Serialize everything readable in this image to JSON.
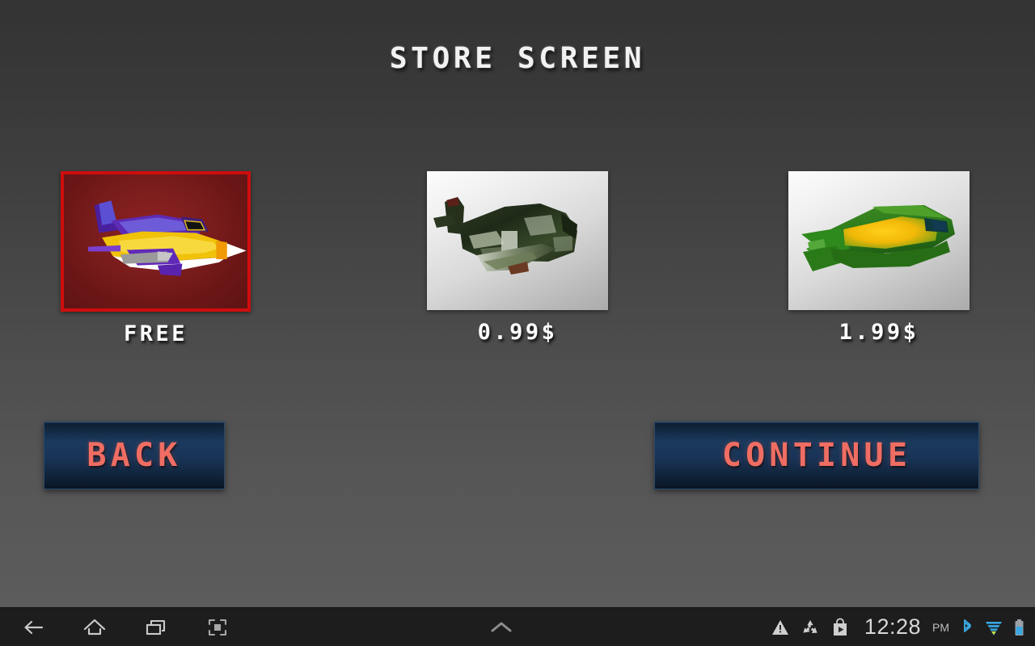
{
  "screen": {
    "title": "STORE SCREEN"
  },
  "products": [
    {
      "id": "plane-free",
      "price_label": "FREE",
      "selected": true,
      "art_name": "purple-yellow-jet-thumbnail",
      "frame_color": "#cf0d0d",
      "background": "#7d1d1d"
    },
    {
      "id": "plane-camo",
      "price_label": "0.99$",
      "selected": false,
      "art_name": "camo-green-fighter-thumbnail",
      "frame_color": "#d9d9d9",
      "background": "#e8e8e8"
    },
    {
      "id": "plane-green",
      "price_label": "1.99$",
      "selected": false,
      "art_name": "green-yellow-jet-thumbnail",
      "frame_color": "#d9d9d9",
      "background": "#e8e8e8"
    }
  ],
  "buttons": {
    "back_label": "BACK",
    "continue_label": "CONTINUE",
    "text_color": "#ef6d63",
    "fill_color": "#173354"
  },
  "navbar": {
    "icons": [
      {
        "name": "back-icon",
        "label": "Back"
      },
      {
        "name": "home-icon",
        "label": "Home"
      },
      {
        "name": "recent-apps-icon",
        "label": "Recent apps"
      },
      {
        "name": "screenshot-icon",
        "label": "Screenshot"
      }
    ],
    "center_icon": {
      "name": "chevron-up-icon",
      "label": "Show menu"
    }
  },
  "statusbar": {
    "icons": [
      {
        "name": "warning-triangle-icon"
      },
      {
        "name": "recycle-icon"
      },
      {
        "name": "play-store-icon"
      }
    ],
    "time": "12:28",
    "meridiem": "PM",
    "indicators": [
      {
        "name": "bluetooth-icon",
        "color": "#3aa7e0"
      },
      {
        "name": "wifi-icon",
        "color": "#3aa7e0"
      },
      {
        "name": "battery-icon",
        "color": "#3aa7e0"
      }
    ]
  }
}
